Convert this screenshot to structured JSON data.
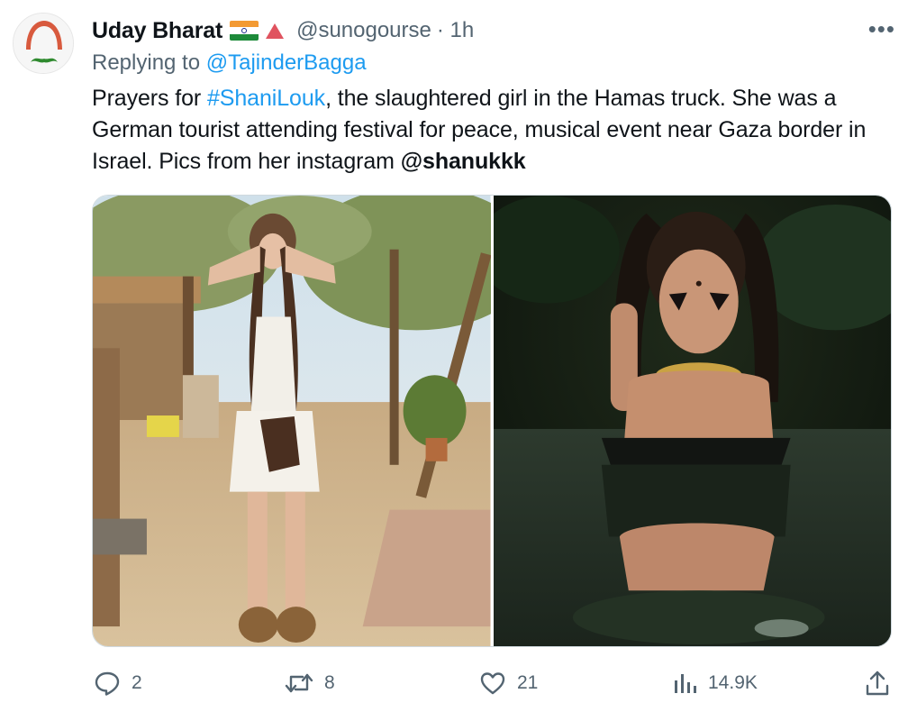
{
  "user": {
    "name": "Uday Bharat",
    "handle": "@sunogourse",
    "time": "· 1h",
    "flag_icon": "india-flag-icon",
    "badge_icon": "red-triangle-icon"
  },
  "reply": {
    "prefix": "Replying to ",
    "mention": "@TajinderBagga"
  },
  "tweet": {
    "t1": "Prayers for ",
    "hashtag": "#ShaniLouk",
    "t2": ", the slaughtered girl in the Hamas truck. She was a German tourist attending festival for peace, musical event near Gaza border in Israel. Pics from her instagram ",
    "mention": "@shanukkk"
  },
  "media": [
    {
      "name": "photo-desert-festival"
    },
    {
      "name": "photo-water-portrait"
    }
  ],
  "actions": {
    "replies": "2",
    "retweets": "8",
    "likes": "21",
    "views": "14.9K"
  },
  "colors": {
    "accent": "#1d9bf0",
    "secondary_text": "#536471",
    "primary_text": "#0f1419"
  }
}
